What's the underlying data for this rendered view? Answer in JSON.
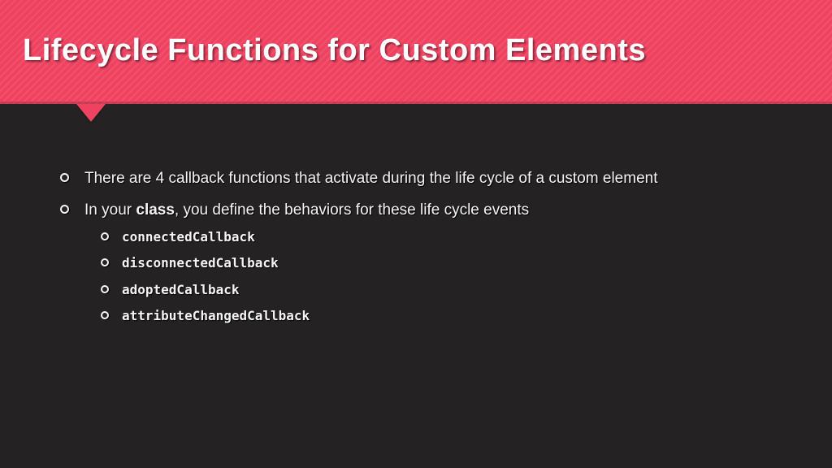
{
  "header": {
    "title": "Lifecycle Functions for Custom Elements"
  },
  "bullets": [
    {
      "text": "There are 4 callback functions that activate during the life cycle of a custom element"
    },
    {
      "prefix": "In your ",
      "bold": "class",
      "suffix": ", you define the behaviors for these life cycle events",
      "sub": [
        "connectedCallback",
        "disconnectedCallback",
        "adoptedCallback",
        "attributeChangedCallback"
      ]
    }
  ]
}
